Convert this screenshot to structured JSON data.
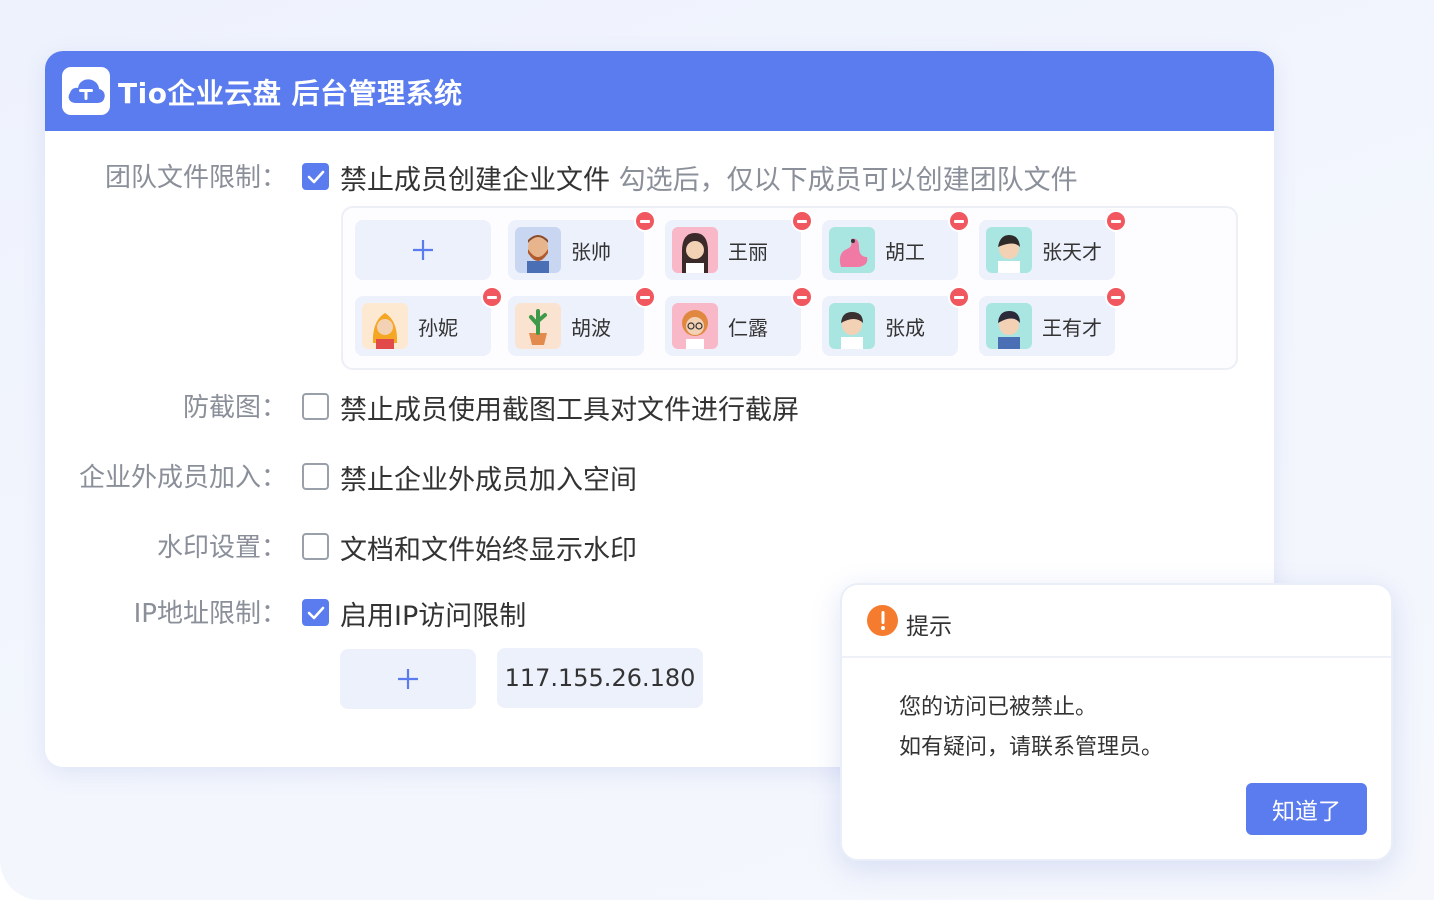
{
  "header": {
    "title": "Tio企业云盘 后台管理系统",
    "logo_icon": "cloud-upload-icon"
  },
  "settings": {
    "team_file": {
      "label": "团队文件限制：",
      "checked": true,
      "option": "禁止成员创建企业文件",
      "hint": "勾选后，仅以下成员可以创建团队文件"
    },
    "members": [
      {
        "name": "张帅"
      },
      {
        "name": "王丽"
      },
      {
        "name": "胡工"
      },
      {
        "name": "张天才"
      },
      {
        "name": "孙妮"
      },
      {
        "name": "胡波"
      },
      {
        "name": "仁露"
      },
      {
        "name": "张成"
      },
      {
        "name": "王有才"
      }
    ],
    "add_symbol": "+",
    "screenshot": {
      "label": "防截图：",
      "checked": false,
      "option": "禁止成员使用截图工具对文件进行截屏"
    },
    "external": {
      "label": "企业外成员加入：",
      "checked": false,
      "option": "禁止企业外成员加入空间"
    },
    "watermark": {
      "label": "水印设置：",
      "checked": false,
      "option": "文档和文件始终显示水印"
    },
    "ip": {
      "label": "IP地址限制：",
      "checked": true,
      "option": "启用IP访问限制",
      "addresses": [
        "117.155.26.180"
      ]
    }
  },
  "dialog": {
    "title": "提示",
    "icon": "warning-icon",
    "message_line1": "您的访问已被禁止。",
    "message_line2": "如有疑问，请联系管理员。",
    "ok_label": "知道了"
  },
  "colors": {
    "primary": "#5b7cee",
    "remove": "#f0575e",
    "warning": "#f57c2e"
  }
}
